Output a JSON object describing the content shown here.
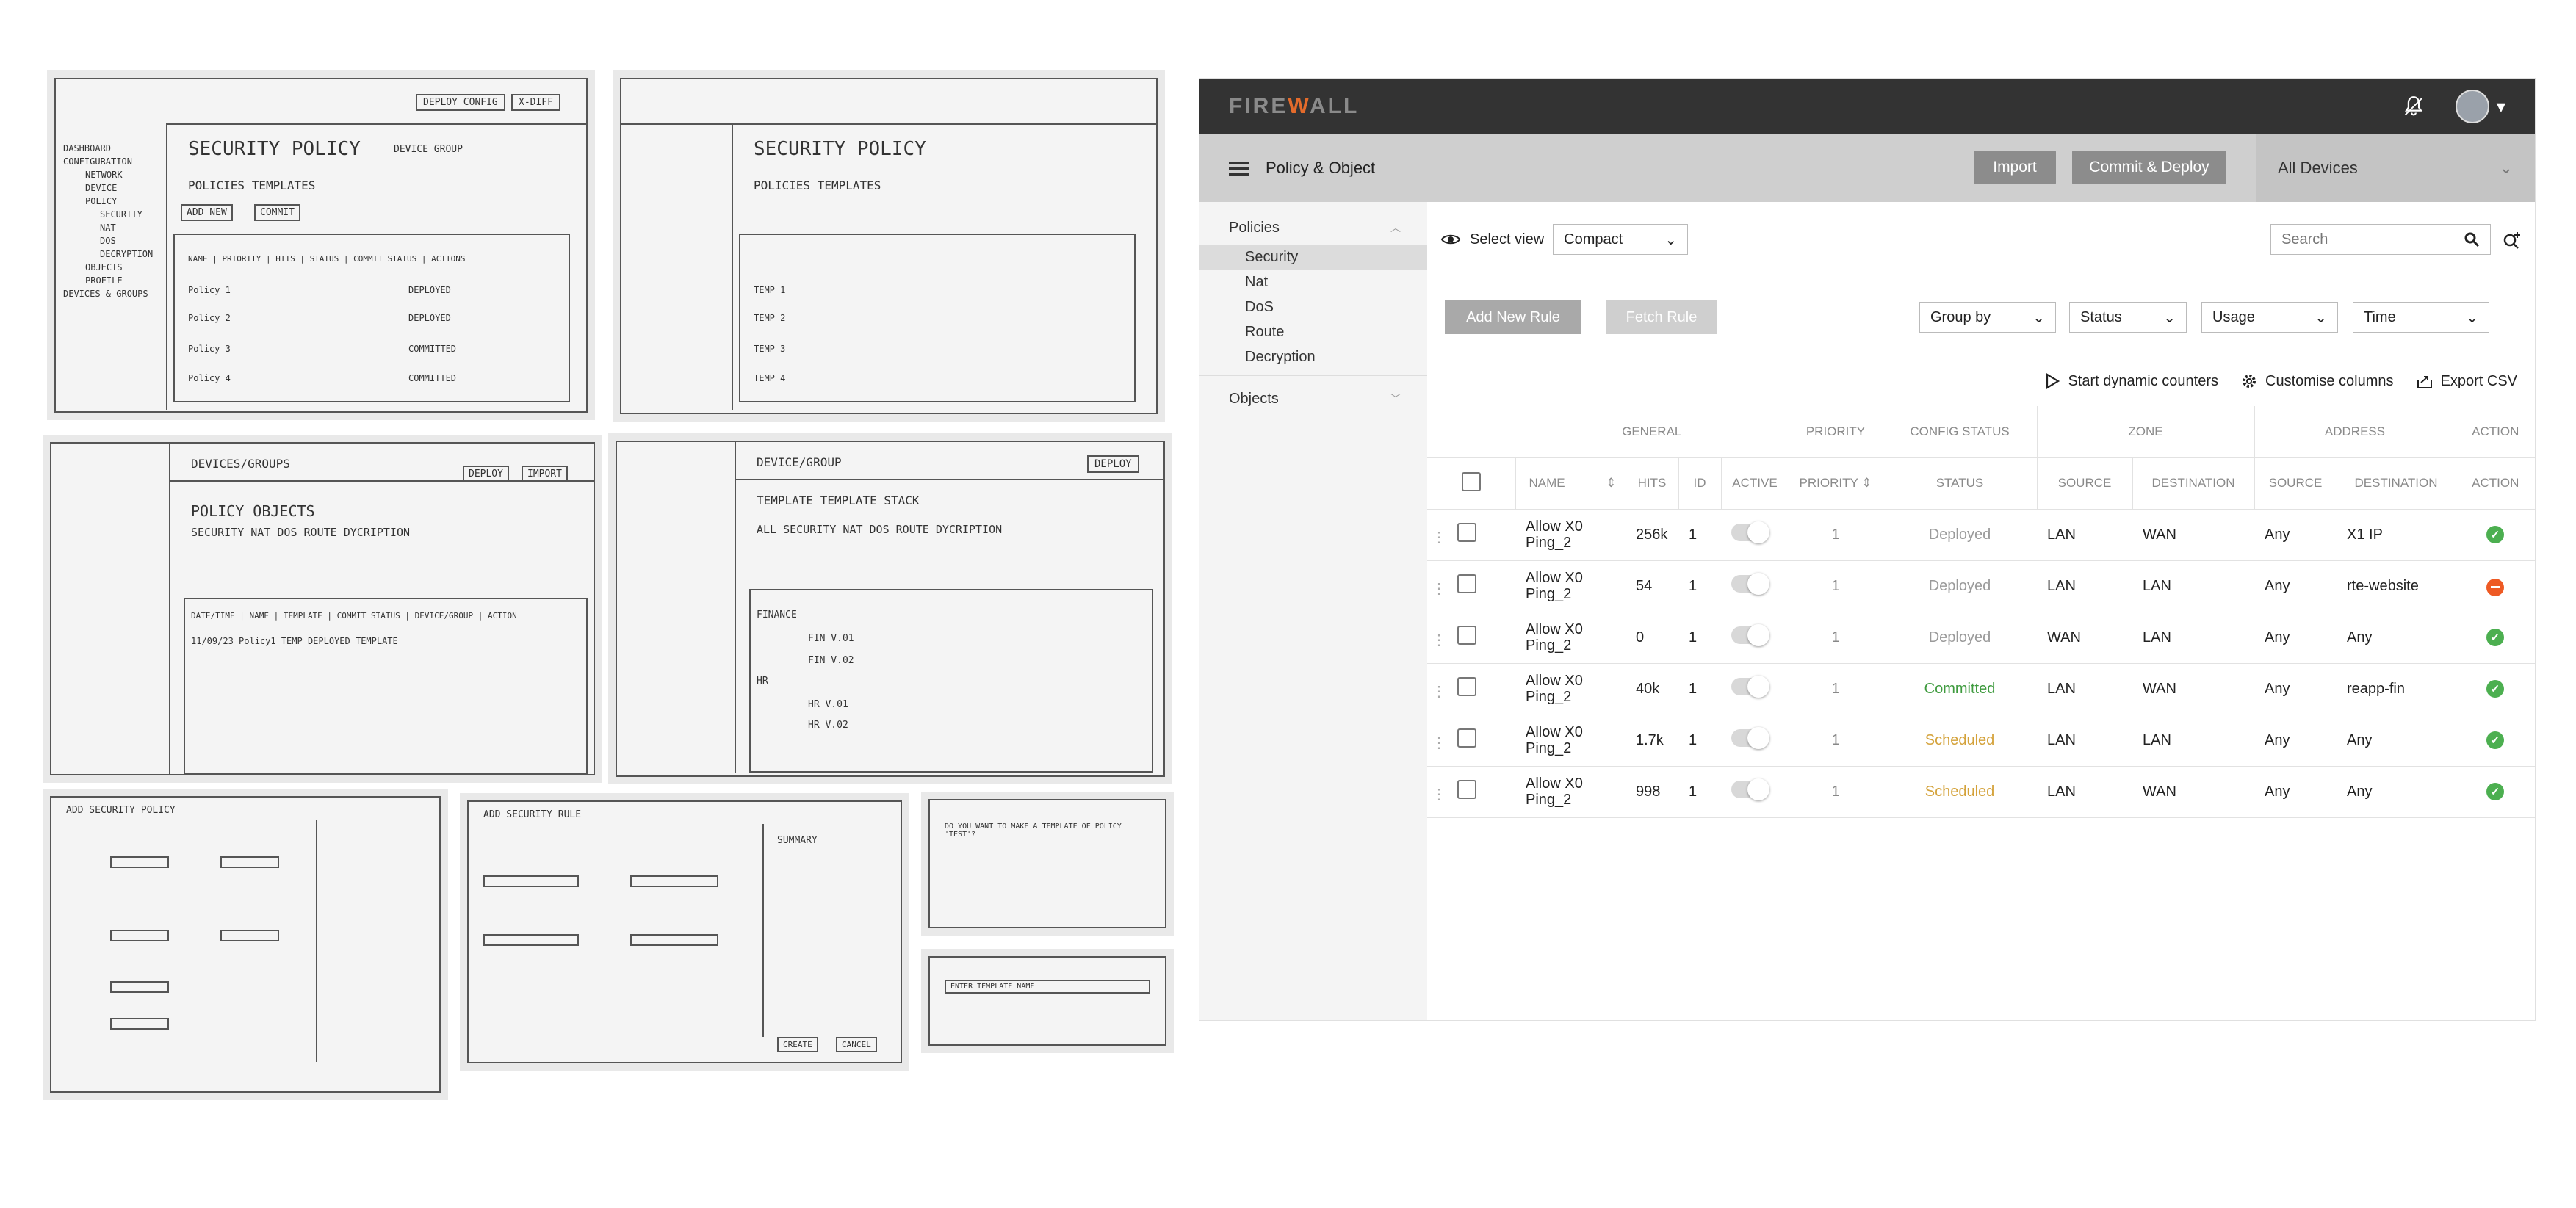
{
  "sketches": {
    "s1": {
      "title": "SECURITY POLICY",
      "btn1": "DEPLOY CONFIG",
      "btn2": "X-DIFF",
      "group": "DEVICE GROUP",
      "nav": [
        "DASHBOARD",
        "CONFIGURATION",
        "NETWORK",
        "DEVICE",
        "POLICY",
        "SECURITY",
        "NAT",
        "DOS",
        "DECRYPTION",
        "OBJECTS",
        "PROFILE",
        "DEVICES & GROUPS"
      ],
      "tabs": "POLICIES   TEMPLATES",
      "addnew": "ADD NEW",
      "commit": "COMMIT",
      "head": "NAME | PRIORITY | HITS | STATUS | COMMIT STATUS | ACTIONS",
      "rows": [
        "Policy 1",
        "Policy 2",
        "Policy 3",
        "Policy 4"
      ],
      "status": [
        "DEPLOYED",
        "DEPLOYED",
        "COMMITTED",
        "COMMITTED"
      ]
    },
    "s2": {
      "title": "SECURITY POLICY",
      "tabs": "POLICIES   TEMPLATES",
      "rows": [
        "TEMP 1",
        "TEMP 2",
        "TEMP 3",
        "TEMP 4"
      ]
    },
    "s3": {
      "title": "DEVICES/GROUPS",
      "tabs": "POLICY   OBJECTS",
      "sub": "SECURITY  NAT  DOS  ROUTE  DYCRIPTION",
      "btn1": "DEPLOY",
      "btn2": "IMPORT",
      "head": "DATE/TIME | NAME | TEMPLATE | COMMIT STATUS | DEVICE/GROUP | ACTION",
      "row": "11/09/23   Policy1   TEMP   DEPLOYED   TEMPLATE"
    },
    "s4": {
      "title": "DEVICE/GROUP",
      "btn1": "DEPLOY",
      "tabs": "TEMPLATE   TEMPLATE STACK",
      "sub": "ALL  SECURITY  NAT  DOS  ROUTE  DYCRIPTION",
      "g1": "FINANCE",
      "r1": "FIN V.01",
      "r2": "FIN V.02",
      "g2": "HR",
      "r3": "HR V.01",
      "r4": "HR V.02"
    },
    "s5": {
      "title": "ADD SECURITY POLICY"
    },
    "s6": {
      "title": "ADD SECURITY RULE",
      "summary": "SUMMARY",
      "create": "CREATE",
      "cancel": "CANCEL"
    },
    "s7": {
      "text": "DO YOU WANT TO MAKE A TEMPLATE OF POLICY 'TEST'?"
    },
    "s8": {
      "text": "ENTER TEMPLATE NAME"
    }
  },
  "app": {
    "logo_a": "FIRE",
    "logo_b": "W",
    "logo_c": "ALL",
    "subbar_title": "Policy & Object",
    "import_label": "Import",
    "commit_label": "Commit & Deploy",
    "devices_label": "All Devices",
    "nav": {
      "policies": "Policies",
      "items": [
        "Security",
        "Nat",
        "DoS",
        "Route",
        "Decryption"
      ],
      "objects": "Objects"
    },
    "select_view": "Select view",
    "view_value": "Compact",
    "search_placeholder": "Search",
    "add_rule": "Add New Rule",
    "fetch_rule": "Fetch Rule",
    "filters": [
      "Group by",
      "Status",
      "Usage",
      "Time"
    ],
    "actions": [
      "Start dynamic counters",
      "Customise columns",
      "Export CSV"
    ],
    "groups": [
      "GENERAL",
      "PRIORITY",
      "CONFIG STATUS",
      "ZONE",
      "ADDRESS",
      "ACTION"
    ],
    "columns": [
      "NAME",
      "HITS",
      "ID",
      "ACTIVE",
      "PRIORITY",
      "STATUS",
      "SOURCE",
      "DESTINATION",
      "SOURCE",
      "DESTINATION",
      "ACTION"
    ],
    "rows": [
      {
        "name": "Allow X0 Ping_2",
        "hits": "256k",
        "id": "1",
        "priority": "1",
        "status": "Deployed",
        "zsrc": "LAN",
        "zdst": "WAN",
        "asrc": "Any",
        "adst": "X1 IP",
        "action": "ok"
      },
      {
        "name": "Allow X0 Ping_2",
        "hits": "54",
        "id": "1",
        "priority": "1",
        "status": "Deployed",
        "zsrc": "LAN",
        "zdst": "LAN",
        "asrc": "Any",
        "adst": "rte-website",
        "action": "deny"
      },
      {
        "name": "Allow X0 Ping_2",
        "hits": "0",
        "id": "1",
        "priority": "1",
        "status": "Deployed",
        "zsrc": "WAN",
        "zdst": "LAN",
        "asrc": "Any",
        "adst": "Any",
        "action": "ok"
      },
      {
        "name": "Allow X0 Ping_2",
        "hits": "40k",
        "id": "1",
        "priority": "1",
        "status": "Committed",
        "zsrc": "LAN",
        "zdst": "WAN",
        "asrc": "Any",
        "adst": "reapp-fin",
        "action": "ok"
      },
      {
        "name": "Allow X0 Ping_2",
        "hits": "1.7k",
        "id": "1",
        "priority": "1",
        "status": "Scheduled",
        "zsrc": "LAN",
        "zdst": "LAN",
        "asrc": "Any",
        "adst": "Any",
        "action": "ok"
      },
      {
        "name": "Allow X0 Ping_2",
        "hits": "998",
        "id": "1",
        "priority": "1",
        "status": "Scheduled",
        "zsrc": "LAN",
        "zdst": "WAN",
        "asrc": "Any",
        "adst": "Any",
        "action": "ok"
      }
    ],
    "status_colors": {
      "Deployed": "#9a9a9a",
      "Committed": "#3f9b3f",
      "Scheduled": "#d4a23a"
    }
  }
}
